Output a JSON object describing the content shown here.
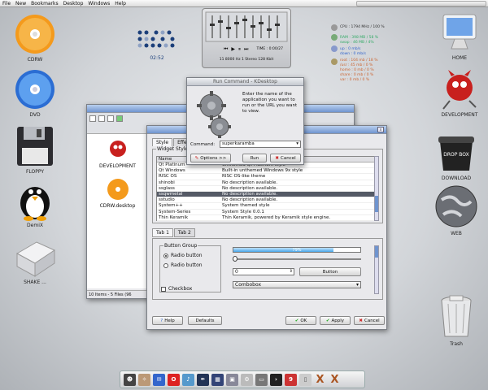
{
  "menubar": {
    "items": [
      "File",
      "New",
      "Bookmarks",
      "Desktop",
      "Windows",
      "Help"
    ]
  },
  "desktop_icons": [
    {
      "label": "CDRW"
    },
    {
      "label": "DVD"
    },
    {
      "label": "FLOPPY"
    },
    {
      "label": "DemiX"
    },
    {
      "label": "SHAKE ..."
    },
    {
      "label": "HOME"
    },
    {
      "label": "DEVELOPMENT"
    },
    {
      "label": "DOWNLOAD"
    },
    {
      "label": "WEB"
    },
    {
      "label": "Trash"
    }
  ],
  "clock": {
    "time": "02:52"
  },
  "media": {
    "time_label": "TIME : 0:00/27",
    "track": "11 8000 Hz 1 Stereo 128 Kbit"
  },
  "sys": {
    "cpu": "CPU : 1794 MHz / 100 %",
    "ram": "RAM : 398 MB / 58 %",
    "swap": "swap : 46 MB / 4%",
    "up": "up : 0 mb/s",
    "down": "down : 0 mb/s",
    "root": "root : 104 mb / 18 %",
    "usr": "/usr : 45 mb / 0 %",
    "home": "home : 0 mb / 0 %",
    "share": "share : 0 mb / 0 %",
    "var": "var : 0 mb / 0 %"
  },
  "run_dialog": {
    "title": "Run Command - KDesktop",
    "prompt": "Enter the name of the application you want to run or the URL you want to view.",
    "command_label": "Command:",
    "command_value": "superkaramba",
    "options": "Options >>",
    "run": "Run",
    "cancel": "Cancel"
  },
  "filemanager": {
    "items": [
      {
        "label": "DEVELOPMENT"
      },
      {
        "label": "CDRW.desktop"
      }
    ],
    "status": "10 Items - 5 Files (96"
  },
  "style_dialog": {
    "tabs": [
      "Style",
      "Effects"
    ],
    "group_title": "Widget Style",
    "col_name": "Name",
    "styles": [
      {
        "name": "Qt Platinum",
        "desc": "Unthemed Qt Platinum style"
      },
      {
        "name": "Qt Windows",
        "desc": "Built-in unthemed Windows 9x style"
      },
      {
        "name": "RISC OS",
        "desc": "RISC OS-like theme"
      },
      {
        "name": "shinobi",
        "desc": "No description available."
      },
      {
        "name": "ssglass",
        "desc": "No description available."
      },
      {
        "name": "ssqwmetal",
        "desc": "No description available."
      },
      {
        "name": "sstudio",
        "desc": "No description available."
      },
      {
        "name": "System++",
        "desc": "System themed style"
      },
      {
        "name": "System-Series",
        "desc": "System Style 0.0.1"
      },
      {
        "name": "Thin Keramik",
        "desc": "Thin Keramik, powered by Keramik style engine."
      }
    ],
    "selected_index": 5,
    "preview_tabs": [
      "Tab 1",
      "Tab 2"
    ],
    "button_group": "Button Group",
    "radio1": "Radio button",
    "radio2": "Radio button",
    "checkbox": "Checkbox",
    "progress_label": "79%",
    "progress_value": 79,
    "slider_value": 0,
    "spin_value": "0",
    "button": "Button",
    "combobox": "Combobox",
    "help": "Help",
    "defaults": "Defaults",
    "ok": "OK",
    "apply": "Apply",
    "cancel": "Cancel"
  },
  "colors": {
    "selection": "#555a66",
    "accent": "#6f94cf"
  }
}
